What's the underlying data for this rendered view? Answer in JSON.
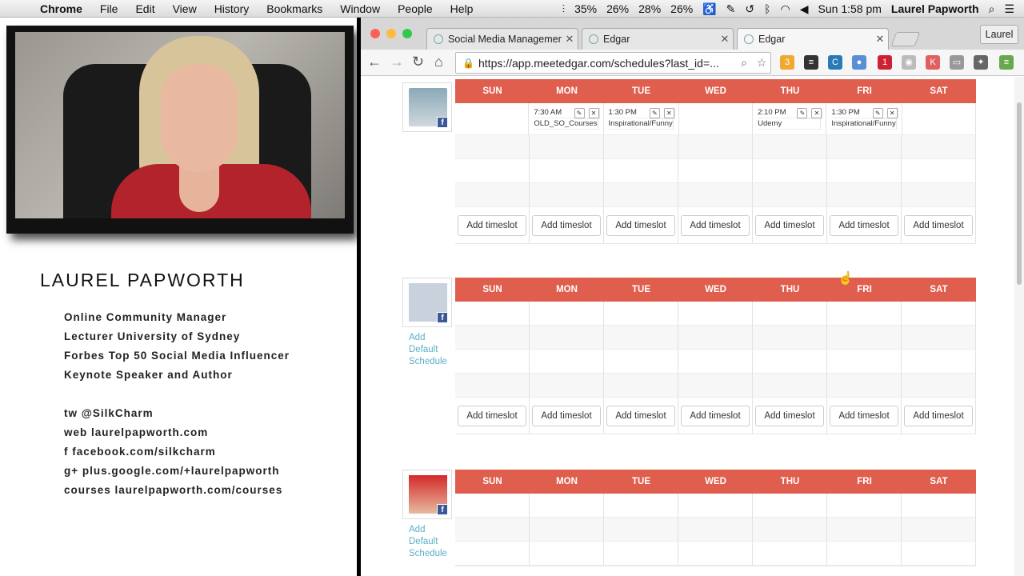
{
  "menubar": {
    "app": "Chrome",
    "items": [
      "File",
      "Edit",
      "View",
      "History",
      "Bookmarks",
      "Window",
      "People",
      "Help"
    ],
    "stats": [
      "35%",
      "26%",
      "28%",
      "26%"
    ],
    "clock": "Sun 1:58 pm",
    "user": "Laurel Papworth"
  },
  "presenter": {
    "name": "LAUREL PAPWORTH",
    "roles": [
      "Online Community Manager",
      "Lecturer University of Sydney",
      "Forbes Top 50 Social Media Influencer",
      "Keynote Speaker and Author"
    ],
    "links": [
      "tw @SilkCharm",
      "web laurelpapworth.com",
      "f facebook.com/silkcharm",
      "g+ plus.google.com/+laurelpapworth",
      "courses laurelpapworth.com/courses"
    ]
  },
  "browser": {
    "tabs": [
      "Social Media Management",
      "Edgar",
      "Edgar"
    ],
    "profile": "Laurel",
    "url": "https://app.meetedgar.com/schedules?last_id=...",
    "ext_badge": "3",
    "ext_badge2": "1"
  },
  "schedule": {
    "days": [
      "SUN",
      "MON",
      "TUE",
      "WED",
      "THU",
      "FRI",
      "SAT"
    ],
    "add_timeslot": "Add timeslot",
    "add_default": "Add Default Schedule",
    "slots": {
      "mon": {
        "time": "7:30 AM",
        "label": "OLD_SO_Courses"
      },
      "tue": {
        "time": "1:30 PM",
        "label": "Inspirational/Funny"
      },
      "thu": {
        "time": "2:10 PM",
        "label": "Udemy"
      },
      "fri": {
        "time": "1:30 PM",
        "label": "Inspirational/Funny"
      }
    }
  }
}
